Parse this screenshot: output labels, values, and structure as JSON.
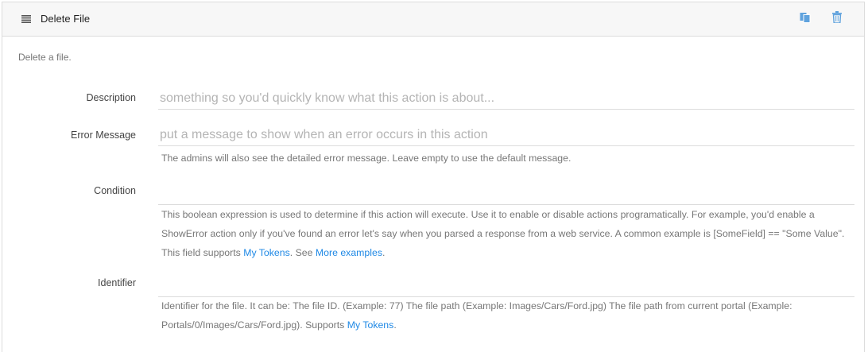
{
  "header": {
    "title": "Delete File",
    "icons": {
      "drag": "list-icon",
      "copy": "copy-icon",
      "delete": "trash-icon"
    },
    "accent_color": "#5fa2dd"
  },
  "summary": "Delete a file.",
  "fields": {
    "description": {
      "label": "Description",
      "placeholder": "something so you'd quickly know what this action is about...",
      "value": ""
    },
    "error_message": {
      "label": "Error Message",
      "placeholder": "put a message to show when an error occurs in this action",
      "value": "",
      "help": "The admins will also see the detailed error message. Leave empty to use the default message."
    },
    "condition": {
      "label": "Condition",
      "value": "",
      "help_text": "This boolean expression is used to determine if this action will execute. Use it to enable or disable actions programatically. For example, you'd enable a ShowError action only if you've found an error let's say when you parsed a response from a web service. A common example is [SomeField] == \"Some Value\". This field supports ",
      "link_tokens": "My Tokens",
      "help_mid": ". See ",
      "link_examples": "More examples",
      "help_end": "."
    },
    "identifier": {
      "label": "Identifier",
      "value": "",
      "help_text": "Identifier for the file. It can be: The file ID. (Example: 77) The file path (Example: Images/Cars/Ford.jpg) The file path from current portal (Example: Portals/0/Images/Cars/Ford.jpg). Supports ",
      "link_tokens": "My Tokens",
      "help_end": "."
    }
  },
  "colors": {
    "link": "#1e88e5",
    "border": "#dcdcdc",
    "header_bg": "#f7f7f7"
  }
}
